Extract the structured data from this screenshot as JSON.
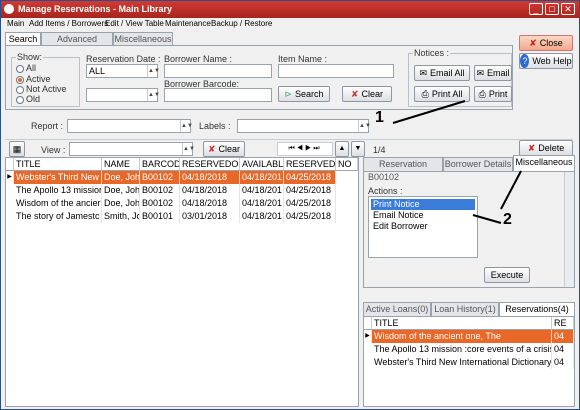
{
  "window": {
    "title": "Manage Reservations - Main Library"
  },
  "menu": [
    "Main",
    "Add Items / Borrowers",
    "Edit / View Table",
    "Maintenance",
    "Backup / Restore"
  ],
  "tabs": [
    "Search",
    "Advanced Search",
    "Miscellaneous"
  ],
  "search": {
    "show_label": "Show:",
    "options": [
      "All",
      "Active",
      "Not Active",
      "Old"
    ],
    "selected_option": "Active",
    "reservation_date_label": "Reservation Date :",
    "reservation_date_value": "ALL",
    "borrower_name_label": "Borrower Name :",
    "borrower_barcode_label": "Borrower Barcode:",
    "item_name_label": "Item Name :",
    "search_button": "Search",
    "clear_button": "Clear"
  },
  "notices": {
    "label": "Notices :",
    "email_all": "Email All",
    "email": "Email",
    "print_all": "Print All",
    "print": "Print"
  },
  "side_buttons": {
    "close": "Close",
    "web_help": "Web Help"
  },
  "report_row": {
    "report_label": "Report :",
    "labels_label": "Labels :"
  },
  "grid_toolbar": {
    "view_label": "View :",
    "clear_button": "Clear",
    "pager": "1/4",
    "delete_button": "Delete"
  },
  "grid": {
    "columns": [
      "TITLE",
      "NAME",
      "BARCODE",
      "RESERVEDON",
      "AVAILABLE",
      "RESERVEDUNTIL",
      "NO"
    ],
    "rows": [
      [
        "Webster's Third New",
        "Doe, John",
        "B00102",
        "04/18/2018",
        "04/18/201",
        "04/25/2018"
      ],
      [
        "The Apollo 13 mission",
        "Doe, John",
        "B00102",
        "04/18/2018",
        "04/18/201",
        "04/25/2018"
      ],
      [
        "Wisdom of the ancier",
        "Doe, John",
        "B00102",
        "04/18/2018",
        "04/18/201",
        "04/25/2018"
      ],
      [
        "The story of Jamestc",
        "Smith, Jc",
        "B00101",
        "03/01/2018",
        "04/18/201",
        "04/25/2018"
      ]
    ],
    "selected_row": 0
  },
  "detail_tabs": [
    "Reservation Details",
    "Borrower Details",
    "Miscellaneous"
  ],
  "misc": {
    "partial_text": "B00102",
    "actions_label": "Actions :",
    "actions": [
      "Print Notice",
      "Email Notice",
      "Edit Borrower"
    ],
    "selected_action": 0,
    "execute_button": "Execute"
  },
  "bottom_tabs": [
    "Active Loans(0)",
    "Loan History(1)",
    "Reservations(4)"
  ],
  "reservations": {
    "columns": [
      "TITLE",
      "RE"
    ],
    "rows": [
      [
        "Wisdom of the ancient one, The",
        "04"
      ],
      [
        "The Apollo 13 mission :core events of a crisis",
        "04"
      ],
      [
        "Webster's Third New International Dictionary",
        "04"
      ]
    ],
    "selected_row": 0
  },
  "callouts": [
    "1",
    "2"
  ],
  "colors": {
    "title_bar": "#b52a23",
    "selection": "#e8682a",
    "list_selection": "#3b7cd9"
  }
}
